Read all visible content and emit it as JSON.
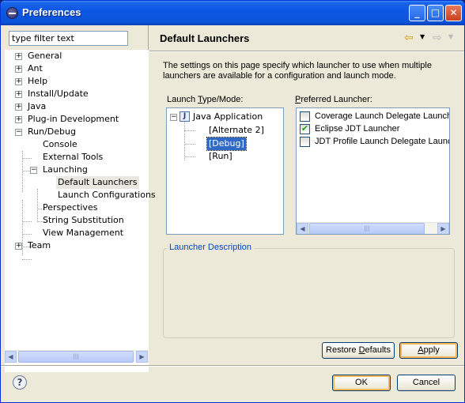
{
  "window": {
    "title": "Preferences",
    "minimize_glyph": "_",
    "maximize_glyph": "□",
    "close_glyph": "✕"
  },
  "filter": {
    "value": "type filter text"
  },
  "tree": [
    {
      "label": "General",
      "expander": "+"
    },
    {
      "label": "Ant",
      "expander": "+"
    },
    {
      "label": "Help",
      "expander": "+"
    },
    {
      "label": "Install/Update",
      "expander": "+"
    },
    {
      "label": "Java",
      "expander": "+"
    },
    {
      "label": "Plug-in Development",
      "expander": "+"
    },
    {
      "label": "Run/Debug",
      "expander": "−"
    },
    {
      "label": "Console"
    },
    {
      "label": "External Tools"
    },
    {
      "label": "Launching",
      "expander": "−"
    },
    {
      "label": "Default Launchers",
      "selected": true
    },
    {
      "label": "Launch Configurations"
    },
    {
      "label": "Perspectives"
    },
    {
      "label": "String Substitution"
    },
    {
      "label": "View Management"
    },
    {
      "label": "Team",
      "expander": "+"
    }
  ],
  "page": {
    "title": "Default Launchers",
    "description": "The settings on this page specify which launcher to use when multiple launchers are available for a configuration and launch mode.",
    "launch_type_label_pre": "Launch ",
    "launch_type_label_u": "T",
    "launch_type_label_post": "ype/Mode:",
    "preferred_label_u": "P",
    "preferred_label_post": "referred Launcher:",
    "launch_tree": {
      "root": "Java Application",
      "root_icon": "J",
      "root_expander": "−",
      "children": [
        "[Alternate 2]",
        "[Debug]",
        "[Run]"
      ]
    },
    "launchers": [
      {
        "label": "Coverage Launch Delegate Launcher",
        "checked": false
      },
      {
        "label": "Eclipse JDT Launcher",
        "checked": true
      },
      {
        "label": "JDT Profile Launch Delegate Launcher",
        "checked": false
      }
    ],
    "launcher_description_label": "Launcher Description",
    "restore_pre": "Restore ",
    "restore_u": "D",
    "restore_post": "efaults",
    "apply_u": "A",
    "apply_post": "pply"
  },
  "scroll": {
    "left": "◀",
    "right": "▶",
    "grip": "|||"
  },
  "check_mark": "✔",
  "footer": {
    "ok": "OK",
    "cancel": "Cancel",
    "help_glyph": "?"
  }
}
